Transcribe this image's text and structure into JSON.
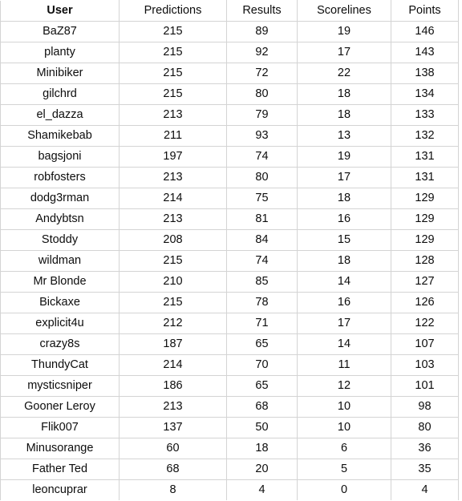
{
  "table": {
    "columns": [
      {
        "key": "user",
        "label": "User",
        "bold": true,
        "class": "col-user"
      },
      {
        "key": "predictions",
        "label": "Predictions",
        "bold": false,
        "class": "col-predictions"
      },
      {
        "key": "results",
        "label": "Results",
        "bold": false,
        "class": "col-results"
      },
      {
        "key": "scorelines",
        "label": "Scorelines",
        "bold": false,
        "class": "col-scorelines"
      },
      {
        "key": "points",
        "label": "Points",
        "bold": false,
        "class": "col-points"
      }
    ],
    "rows": [
      {
        "user": "BaZ87",
        "predictions": "215",
        "results": "89",
        "scorelines": "19",
        "points": "146"
      },
      {
        "user": "planty",
        "predictions": "215",
        "results": "92",
        "scorelines": "17",
        "points": "143"
      },
      {
        "user": "Minibiker",
        "predictions": "215",
        "results": "72",
        "scorelines": "22",
        "points": "138"
      },
      {
        "user": "gilchrd",
        "predictions": "215",
        "results": "80",
        "scorelines": "18",
        "points": "134"
      },
      {
        "user": "el_dazza",
        "predictions": "213",
        "results": "79",
        "scorelines": "18",
        "points": "133"
      },
      {
        "user": "Shamikebab",
        "predictions": "211",
        "results": "93",
        "scorelines": "13",
        "points": "132"
      },
      {
        "user": "bagsjoni",
        "predictions": "197",
        "results": "74",
        "scorelines": "19",
        "points": "131"
      },
      {
        "user": "robfosters",
        "predictions": "213",
        "results": "80",
        "scorelines": "17",
        "points": "131"
      },
      {
        "user": "dodg3rman",
        "predictions": "214",
        "results": "75",
        "scorelines": "18",
        "points": "129"
      },
      {
        "user": "Andybtsn",
        "predictions": "213",
        "results": "81",
        "scorelines": "16",
        "points": "129"
      },
      {
        "user": "Stoddy",
        "predictions": "208",
        "results": "84",
        "scorelines": "15",
        "points": "129"
      },
      {
        "user": "wildman",
        "predictions": "215",
        "results": "74",
        "scorelines": "18",
        "points": "128"
      },
      {
        "user": "Mr Blonde",
        "predictions": "210",
        "results": "85",
        "scorelines": "14",
        "points": "127"
      },
      {
        "user": "Bickaxe",
        "predictions": "215",
        "results": "78",
        "scorelines": "16",
        "points": "126"
      },
      {
        "user": "explicit4u",
        "predictions": "212",
        "results": "71",
        "scorelines": "17",
        "points": "122"
      },
      {
        "user": "crazy8s",
        "predictions": "187",
        "results": "65",
        "scorelines": "14",
        "points": "107"
      },
      {
        "user": "ThundyCat",
        "predictions": "214",
        "results": "70",
        "scorelines": "11",
        "points": "103"
      },
      {
        "user": "mysticsniper",
        "predictions": "186",
        "results": "65",
        "scorelines": "12",
        "points": "101"
      },
      {
        "user": "Gooner Leroy",
        "predictions": "213",
        "results": "68",
        "scorelines": "10",
        "points": "98"
      },
      {
        "user": "Flik007",
        "predictions": "137",
        "results": "50",
        "scorelines": "10",
        "points": "80"
      },
      {
        "user": "Minusorange",
        "predictions": "60",
        "results": "18",
        "scorelines": "6",
        "points": "36"
      },
      {
        "user": "Father Ted",
        "predictions": "68",
        "results": "20",
        "scorelines": "5",
        "points": "35"
      },
      {
        "user": "leoncuprar",
        "predictions": "8",
        "results": "4",
        "scorelines": "0",
        "points": "4"
      }
    ]
  },
  "colors": {
    "border": "#d4d4d4",
    "text": "#0d0d0d",
    "background": "#ffffff"
  }
}
